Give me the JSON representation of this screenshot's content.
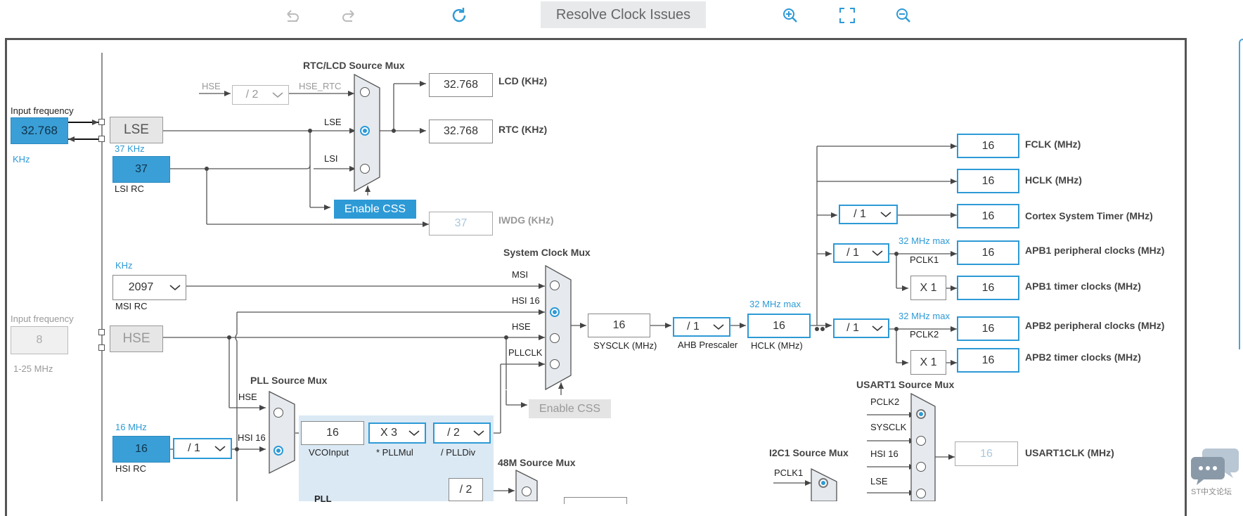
{
  "toolbar": {
    "undo_icon": "undo-icon",
    "redo_icon": "redo-icon",
    "refresh_icon": "refresh-icon",
    "resolve_label": "Resolve Clock Issues",
    "zoom_in_icon": "zoom-in-icon",
    "fit_icon": "fit-screen-icon",
    "zoom_out_icon": "zoom-out-icon"
  },
  "colors": {
    "accent": "#2d9ad6",
    "fill": "#3a9fd6",
    "gray": "#e6e6e6",
    "line": "#555555"
  },
  "lse_section": {
    "input_freq_label": "Input frequency",
    "input_freq_value": "32.768",
    "unit": "KHz",
    "lse_label": "LSE",
    "lsi_freq_label": "37 KHz",
    "lsi_value": "37",
    "lsi_rc_label": "LSI RC"
  },
  "rtc_mux": {
    "title": "RTC/LCD Source Mux",
    "hse_label": "HSE",
    "div_value": "/ 2",
    "hse_rtc_label": "HSE_RTC",
    "lse_label": "LSE",
    "lsi_label": "LSI",
    "enable_css": "Enable CSS"
  },
  "rtc_outputs": {
    "lcd_value": "32.768",
    "lcd_label": "LCD (KHz)",
    "rtc_value": "32.768",
    "rtc_label": "RTC (KHz)",
    "iwdg_value": "37",
    "iwdg_label": "IWDG (KHz)"
  },
  "msi": {
    "unit": "KHz",
    "value": "2097",
    "label": "MSI RC"
  },
  "hse": {
    "input_freq_label": "Input frequency",
    "value": "8",
    "label": "HSE",
    "range": "1-25 MHz"
  },
  "hsi": {
    "freq_label": "16 MHz",
    "value": "16",
    "label": "HSI RC",
    "div": "/ 1"
  },
  "sys_mux": {
    "title": "System Clock Mux",
    "msi": "MSI",
    "hsi16": "HSI 16",
    "hse": "HSE",
    "pllclk": "PLLCLK",
    "enable_css": "Enable CSS"
  },
  "sysclk": {
    "value": "16",
    "label": "SYSCLK (MHz)"
  },
  "ahb": {
    "value": "/ 1",
    "label": "AHB Prescaler"
  },
  "hclk": {
    "max": "32 MHz max",
    "value": "16",
    "label": "HCLK (MHz)"
  },
  "pll": {
    "mux_title": "PLL Source Mux",
    "hse": "HSE",
    "hsi16": "HSI 16",
    "vco_value": "16",
    "vco_label": "VCOInput",
    "mul_value": "X 3",
    "mul_label": "* PLLMul",
    "div_value": "/ 2",
    "div_label": "/ PLLDiv",
    "region_label": "PLL",
    "div2_value": "/ 2",
    "m48_title": "48M Source Mux"
  },
  "outputs": {
    "fclk_value": "16",
    "fclk_label": "FCLK (MHz)",
    "hclk_value": "16",
    "hclk_label": "HCLK (MHz)",
    "cortex_div": "/ 1",
    "cortex_value": "16",
    "cortex_label": "Cortex System Timer (MHz)",
    "apb1_div": "/ 1",
    "apb1_max": "32 MHz max",
    "pclk1": "PCLK1",
    "apb1_value": "16",
    "apb1_label": "APB1 peripheral clocks (MHz)",
    "apb1_timer_mul": "X 1",
    "apb1_timer_value": "16",
    "apb1_timer_label": "APB1 timer clocks (MHz)",
    "apb2_div": "/ 1",
    "apb2_max": "32 MHz max",
    "pclk2": "PCLK2",
    "apb2_value": "16",
    "apb2_label": "APB2 peripheral clocks (MHz)",
    "apb2_timer_mul": "X 1",
    "apb2_timer_value": "16",
    "apb2_timer_label": "APB2 timer clocks (MHz)"
  },
  "usart1": {
    "title": "USART1 Source Mux",
    "pclk2": "PCLK2",
    "sysclk": "SYSCLK",
    "hsi16": "HSI 16",
    "lse": "LSE",
    "value": "16",
    "label": "USART1CLK (MHz)"
  },
  "i2c1": {
    "title": "I2C1 Source Mux",
    "pclk1": "PCLK1"
  },
  "forum": {
    "icon": "chat-bubbles-icon",
    "label": "ST中文论坛"
  }
}
